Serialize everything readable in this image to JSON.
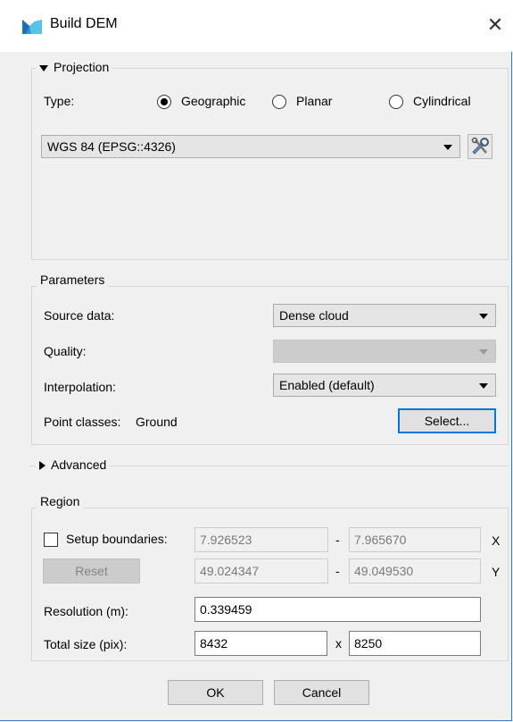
{
  "window": {
    "title": "Build DEM"
  },
  "projection": {
    "title": "Projection",
    "type_label": "Type:",
    "options": [
      "Geographic",
      "Planar",
      "Cylindrical"
    ],
    "selected": "Geographic",
    "crs_value": "WGS 84 (EPSG::4326)"
  },
  "parameters": {
    "title": "Parameters",
    "source_label": "Source data:",
    "source_value": "Dense cloud",
    "quality_label": "Quality:",
    "quality_value": "",
    "interp_label": "Interpolation:",
    "interp_value": "Enabled (default)",
    "point_classes_label": "Point classes:",
    "point_classes_value": "Ground",
    "select_button": "Select..."
  },
  "advanced": {
    "title": "Advanced"
  },
  "region": {
    "title": "Region",
    "setup_label": "Setup boundaries:",
    "reset_button": "Reset",
    "x_min": "7.926523",
    "x_max": "7.965670",
    "y_min": "49.024347",
    "y_max": "49.049530",
    "dash": "-",
    "x_axis": "X",
    "y_axis": "Y",
    "resolution_label": "Resolution (m):",
    "resolution_value": "0.339459",
    "total_label": "Total size (pix):",
    "total_w": "8432",
    "times": "x",
    "total_h": "8250"
  },
  "buttons": {
    "ok": "OK",
    "cancel": "Cancel"
  },
  "colors": {
    "accent": "#0078d7",
    "frame_border": "#2b7fd1"
  }
}
